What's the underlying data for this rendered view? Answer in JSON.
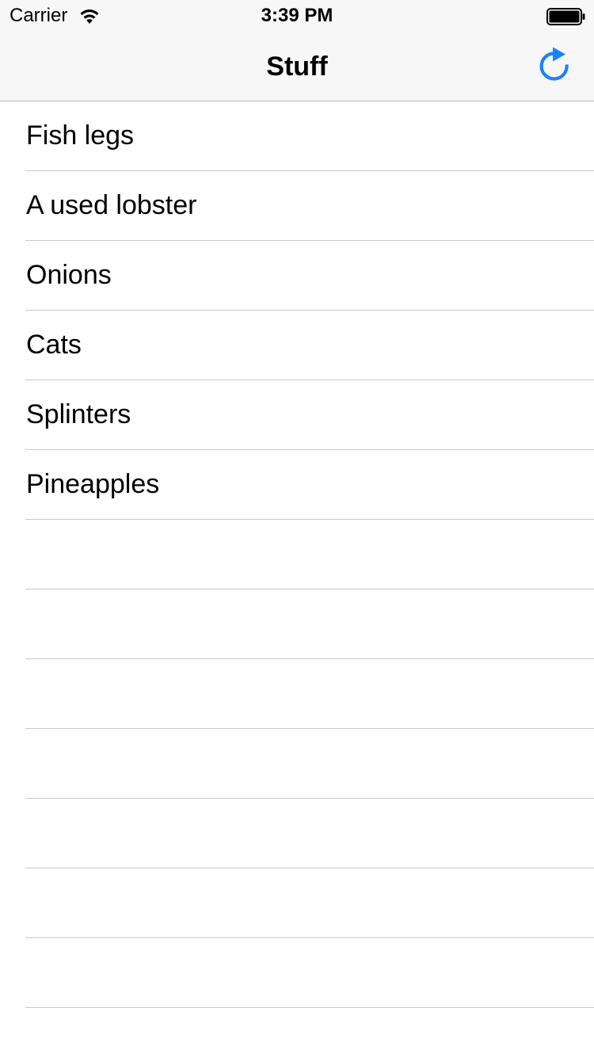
{
  "status_bar": {
    "carrier": "Carrier",
    "time": "3:39 PM"
  },
  "nav_bar": {
    "title": "Stuff",
    "refresh_icon": "refresh-icon",
    "tint_color": "#1a82fb"
  },
  "table": {
    "rows": [
      {
        "label": "Fish legs"
      },
      {
        "label": "A used lobster"
      },
      {
        "label": "Onions"
      },
      {
        "label": "Cats"
      },
      {
        "label": "Splinters"
      },
      {
        "label": "Pineapples"
      },
      {
        "label": ""
      },
      {
        "label": ""
      },
      {
        "label": ""
      },
      {
        "label": ""
      },
      {
        "label": ""
      },
      {
        "label": ""
      },
      {
        "label": ""
      }
    ],
    "separator_color": "#c8c7cc"
  }
}
